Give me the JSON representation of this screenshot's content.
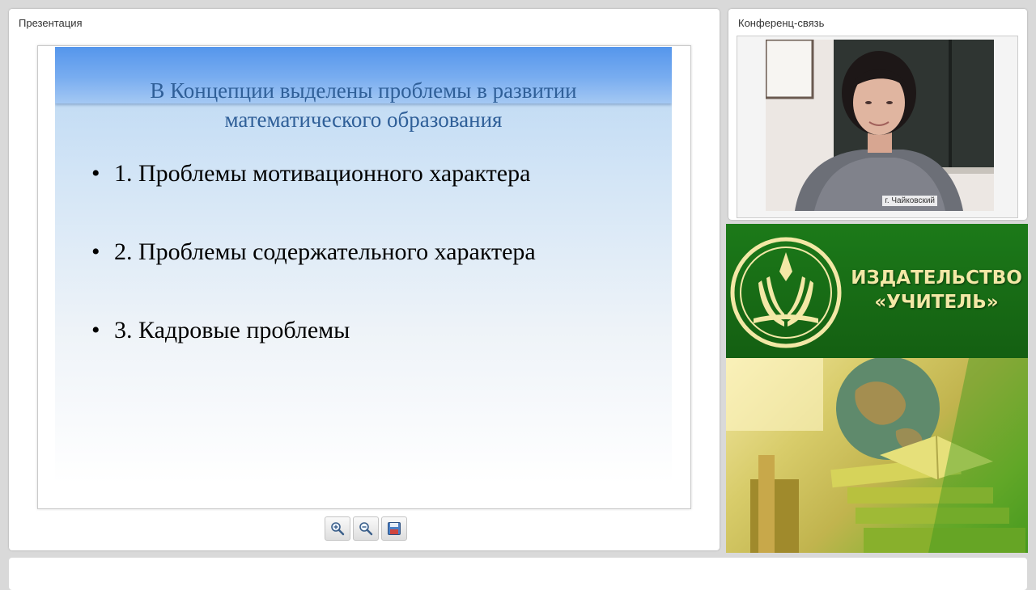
{
  "presentation": {
    "panel_title": "Презентация",
    "slide": {
      "title_line1": "В Концепции выделены проблемы в развитии",
      "title_line2": "математического образования",
      "bullets": [
        "1. Проблемы мотивационного характера",
        "2. Проблемы содержательного характера",
        "3. Кадровые проблемы"
      ],
      "bullet_symbol": "•"
    },
    "toolbar": {
      "zoom_in_icon": "zoom-in-icon",
      "zoom_out_icon": "zoom-out-icon",
      "save_icon": "save-icon"
    }
  },
  "conference": {
    "panel_title": "Конференц-связь",
    "video_caption": "г. Чайковский"
  },
  "publisher": {
    "name_line1": "ИЗДАТЕЛЬСТВО",
    "name_line2": "«УЧИТЕЛЬ»"
  },
  "colors": {
    "slide_band": "#5596ec",
    "slide_title": "#2f5f98",
    "publisher_green": "#1a6e17",
    "publisher_text": "#f3e8a6"
  }
}
